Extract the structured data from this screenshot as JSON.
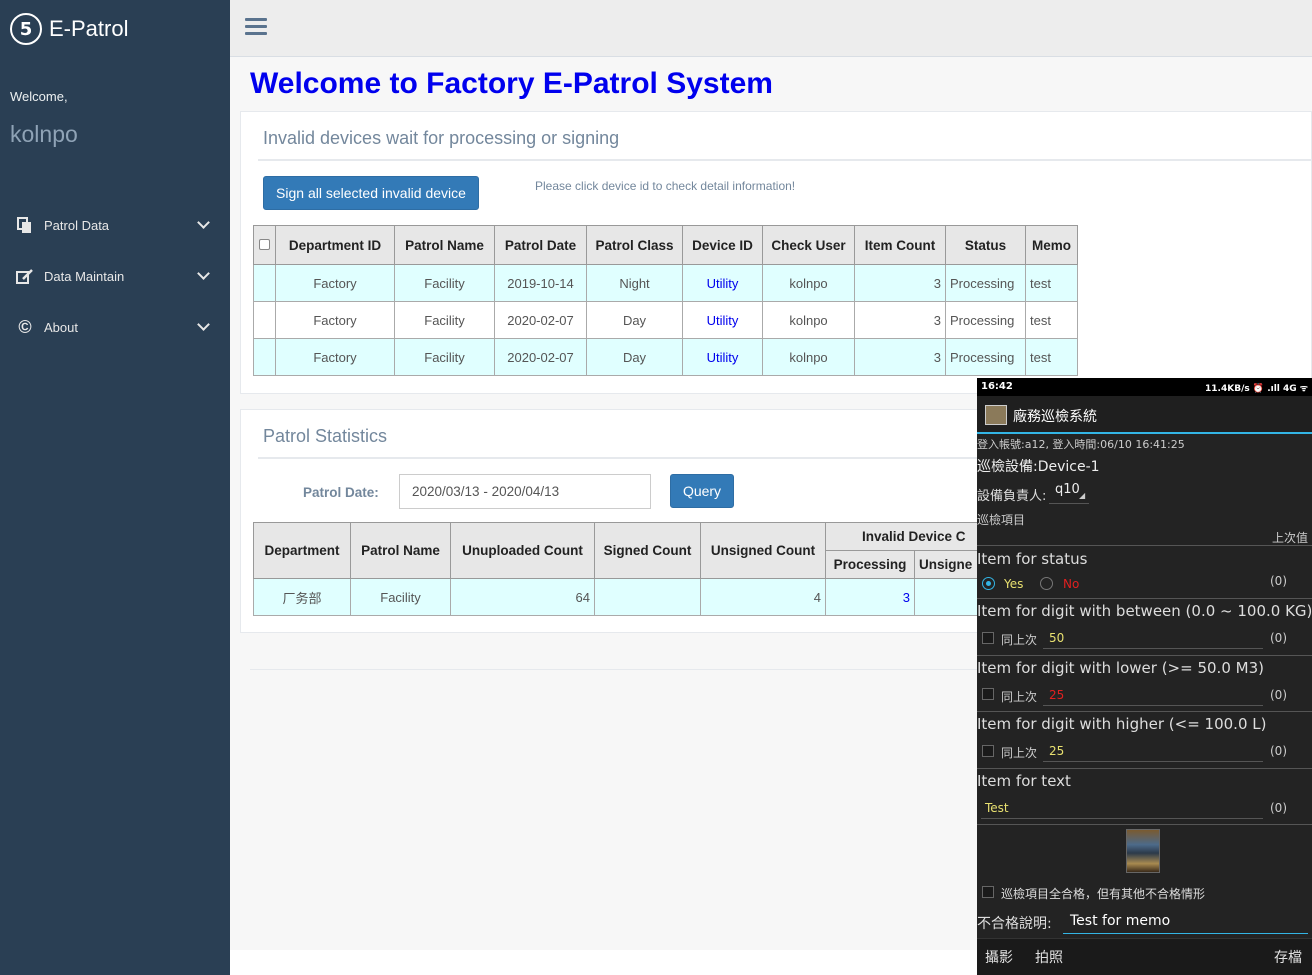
{
  "brand": {
    "name": "E-Patrol",
    "logo_char": "5"
  },
  "sidebar": {
    "welcome": "Welcome,",
    "username": "kolnpo",
    "menu": [
      {
        "label": "Patrol Data",
        "icon": "copy-icon"
      },
      {
        "label": "Data Maintain",
        "icon": "edit-icon"
      },
      {
        "label": "About",
        "icon": "copyright-icon"
      }
    ]
  },
  "header": {
    "menu_toggle": "hamburger-icon"
  },
  "main": {
    "title": "Welcome to Factory E-Patrol System",
    "invalid_panel": {
      "title": "Invalid devices wait for processing or signing",
      "sign_button": "Sign all selected invalid device",
      "hint": "Please click device id to check detail information!",
      "columns": [
        "Department ID",
        "Patrol Name",
        "Patrol Date",
        "Patrol Class",
        "Device ID",
        "Check User",
        "Item Count",
        "Status",
        "Memo"
      ],
      "rows": [
        {
          "department": "Factory",
          "patrol_name": "Facility",
          "date": "2019-10-14",
          "class": "Night",
          "device": "Utility",
          "user": "kolnpo",
          "count": "3",
          "status": "Processing",
          "memo": "test"
        },
        {
          "department": "Factory",
          "patrol_name": "Facility",
          "date": "2020-02-07",
          "class": "Day",
          "device": "Utility",
          "user": "kolnpo",
          "count": "3",
          "status": "Processing",
          "memo": "test"
        },
        {
          "department": "Factory",
          "patrol_name": "Facility",
          "date": "2020-02-07",
          "class": "Day",
          "device": "Utility",
          "user": "kolnpo",
          "count": "3",
          "status": "Processing",
          "memo": "test"
        }
      ]
    },
    "stats_panel": {
      "title": "Patrol Statistics",
      "date_label": "Patrol Date:",
      "date_value": "2020/03/13 - 2020/04/13",
      "query_button": "Query",
      "columns": [
        "Department",
        "Patrol Name",
        "Unuploaded Count",
        "Signed Count",
        "Unsigned Count"
      ],
      "group_header": "Invalid Device C",
      "sub_columns": [
        "Processing",
        "Unsigne"
      ],
      "rows": [
        {
          "department": "厂务部",
          "patrol_name": "Facility",
          "unuploaded": "64",
          "signed": "",
          "unsigned": "4",
          "processing": "3",
          "unsigned_invalid": ""
        }
      ]
    }
  },
  "phone": {
    "status_time": "16:42",
    "status_right": "11.4KB/s ⏰ .ıll 4G ᯤ",
    "app_title": "廠務巡檢系統",
    "login_info": "登入帳號:a12, 登入時間:06/10 16:41:25",
    "device": "巡檢設備:Device-1",
    "owner_label": "設備負責人:",
    "owner_value": "q10",
    "items_header": "巡檢項目",
    "prev_value_header": "上次值",
    "items": [
      {
        "title": "Item for status",
        "yes": "Yes",
        "no": "No",
        "count": "(0)"
      },
      {
        "title": "Item for digit with between  (0.0 ~ 100.0 KG)",
        "same": "同上次",
        "value": "50",
        "count": "(0)"
      },
      {
        "title": "Item for digit with lower  (>= 50.0 M3)",
        "same": "同上次",
        "value": "25",
        "count": "(0)"
      },
      {
        "title": "Item for digit with higher  (<= 100.0 L)",
        "same": "同上次",
        "value": "25",
        "count": "(0)"
      },
      {
        "title": "Item for text",
        "value": "Test",
        "count": "(0)"
      }
    ],
    "all_pass_label": "巡檢項目全合格，但有其他不合格情形",
    "memo_label": "不合格說明:",
    "memo_value": "Test for memo",
    "buttons": {
      "video": "攝影",
      "photo": "拍照",
      "save": "存檔"
    },
    "colors": {
      "accent": "#33b5e5",
      "ok_value": "#e8e070",
      "bad_value": "#e02020"
    }
  }
}
